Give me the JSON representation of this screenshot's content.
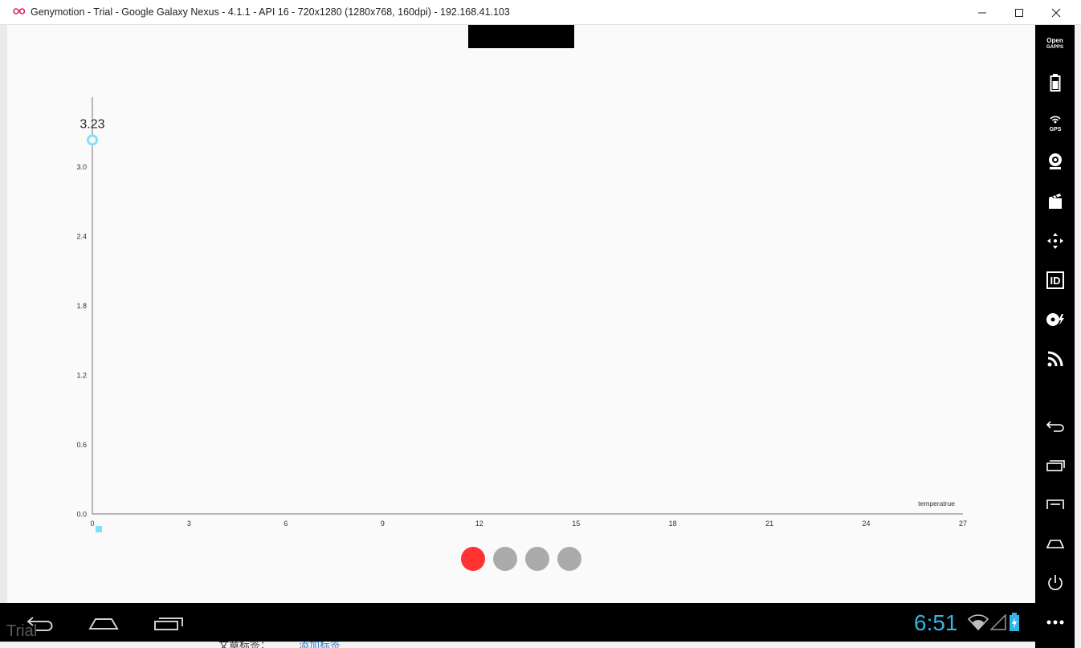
{
  "window": {
    "title": "Genymotion - Trial - Google Galaxy Nexus - 4.1.1 - API 16 - 720x1280 (1280x768, 160dpi) - 192.168.41.103",
    "controls": [
      "minimize-icon",
      "maximize-icon",
      "close-icon"
    ]
  },
  "chart_data": {
    "type": "line",
    "x_tick_labels": [
      "0",
      "3",
      "6",
      "9",
      "12",
      "15",
      "18",
      "21",
      "24",
      "27"
    ],
    "y_tick_labels": [
      "0.0",
      "0.6",
      "1.2",
      "1.8",
      "2.4",
      "3.0"
    ],
    "xlim": [
      0,
      27
    ],
    "ylim": [
      0,
      3.6
    ],
    "x_axis_description": "temperatrue",
    "series": [
      {
        "x": [
          0
        ],
        "y": [
          3.23
        ],
        "value_labels": [
          "3.23"
        ],
        "color": "#7fe3f5"
      }
    ],
    "legend_marker_color": "#7fe3f5",
    "grid": false
  },
  "pager": {
    "count": 4,
    "active_index": 0,
    "active_color": "#ff3333",
    "inactive_color": "#ababab"
  },
  "toolbar": {
    "gapps_label_line1": "Open",
    "gapps_label_line2": "GAPPS",
    "gps_label": "GPS",
    "id_label": "ID",
    "items": [
      "open-gapps-icon",
      "battery-icon",
      "gps-icon",
      "webcam-icon",
      "media-icon",
      "dpad-icon",
      "id-icon",
      "disk-io-icon",
      "network-icon",
      "back-icon",
      "recent-apps-icon",
      "menu-icon",
      "home-icon",
      "power-icon",
      "more-icon"
    ]
  },
  "navbar": {
    "clock": "6:51",
    "watermark": "Trial",
    "buttons": [
      "back-icon",
      "home-icon",
      "recent-apps-icon"
    ]
  },
  "underlying": {
    "text": "文章标签：",
    "link": "添加标签"
  }
}
